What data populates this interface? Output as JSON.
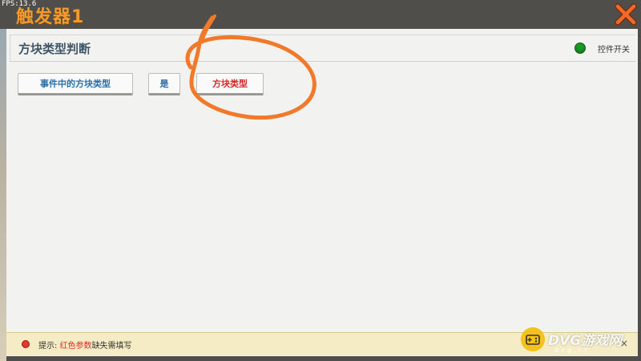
{
  "hud": {
    "fps": "FPS:13.6"
  },
  "window": {
    "title": "触发器1"
  },
  "panel": {
    "title": "方块类型判断",
    "toggle_label": "控件开关",
    "toggle_color": "#1a9a2a"
  },
  "condition": {
    "subject": "事件中的方块类型",
    "operator": "是",
    "object": "方块类型"
  },
  "hint": {
    "prefix": "提示: ",
    "highlight": "红色参数",
    "suffix": "缺失需填写",
    "close": "×"
  },
  "watermark": {
    "brand": "DVG游戏网",
    "domain": "dvg.cc"
  },
  "icons": {
    "close": "close-icon",
    "toggle": "toggle-dot-icon",
    "hint": "hint-dot-icon",
    "watermark": "gamepad-icon"
  },
  "colors": {
    "title": "#f39a2d",
    "param_missing": "#d42a2a",
    "param_set": "#2a6fa8",
    "annotation": "#f07a2a"
  }
}
